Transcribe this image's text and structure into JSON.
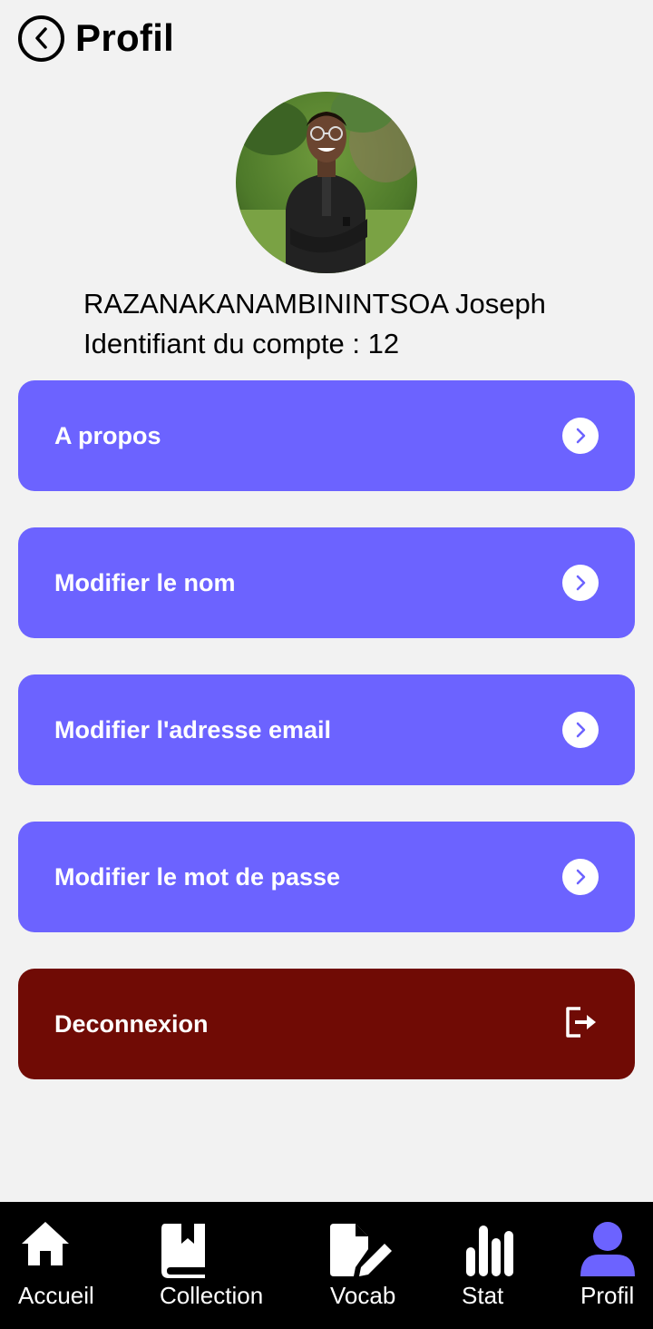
{
  "header": {
    "title": "Profil",
    "back_icon": "back-circle-icon"
  },
  "profile": {
    "name": "RAZANAKANAMBININTSOA Joseph",
    "account_id": "Identifiant du compte : 12"
  },
  "menu": [
    {
      "label": "A propos",
      "icon": "chevron-right-circle-icon"
    },
    {
      "label": "Modifier le nom",
      "icon": "chevron-right-circle-icon"
    },
    {
      "label": "Modifier l'adresse email",
      "icon": "chevron-right-circle-icon"
    },
    {
      "label": "Modifier le mot de passe",
      "icon": "chevron-right-circle-icon"
    }
  ],
  "logout": {
    "label": "Deconnexion",
    "icon": "logout-icon"
  },
  "nav": [
    {
      "label": "Accueil",
      "icon": "home-icon"
    },
    {
      "label": "Collection",
      "icon": "book-icon"
    },
    {
      "label": "Vocab",
      "icon": "edit-document-icon"
    },
    {
      "label": "Stat",
      "icon": "bar-chart-icon"
    },
    {
      "label": "Profil",
      "icon": "user-icon",
      "active": true
    }
  ],
  "colors": {
    "background": "#f2f2f2",
    "accent": "#6c63ff",
    "logout": "#700b05",
    "nav_background": "#000000",
    "nav_active": "#6c63ff"
  }
}
